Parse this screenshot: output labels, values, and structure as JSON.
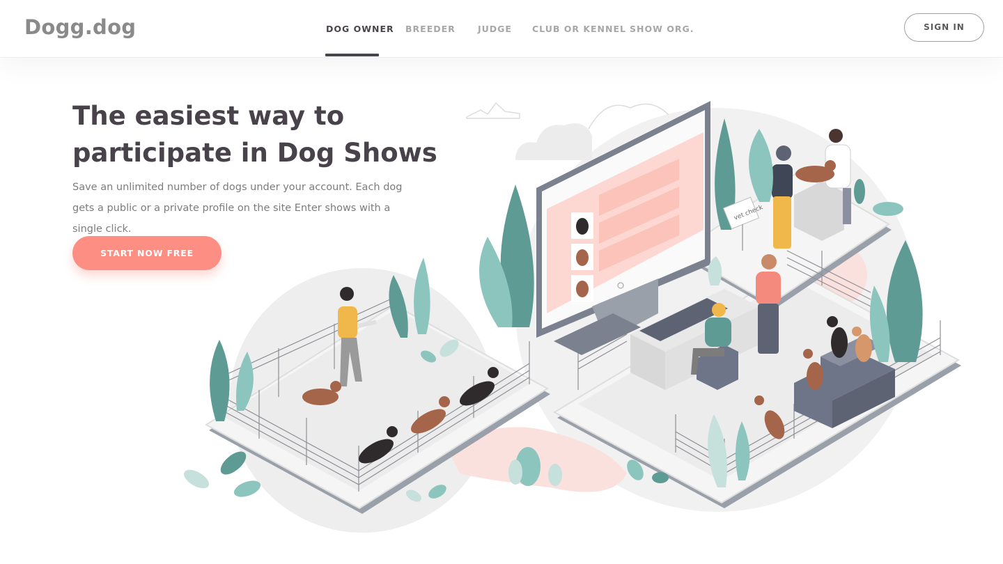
{
  "header": {
    "logo": "Dogg.dog",
    "nav": [
      {
        "label": "DOG OWNER",
        "active": true
      },
      {
        "label": "BREEDER",
        "active": false
      },
      {
        "label": "JUDGE",
        "active": false
      },
      {
        "label": "CLUB OR KENNEL",
        "active": false
      },
      {
        "label": "SHOW ORG.",
        "active": false
      }
    ],
    "signin_label": "SIGN IN"
  },
  "hero": {
    "title": "The easiest way to participate in Dog Shows",
    "subtitle": "Save an unlimited number of dogs under your account. Each dog gets a public or a private profile on the site Enter shows with a single click.",
    "cta_label": "START NOW FREE"
  },
  "illustration": {
    "sign_label": "vet check",
    "icons": [
      "dog-show-illustration",
      "computer-monitor-icon",
      "keyboard-icon",
      "plant-icon",
      "dog-icon",
      "person-icon"
    ]
  },
  "colors": {
    "accent": "#fd8e83",
    "nav_active": "#4a444c",
    "nav_inactive": "#a7a7a7",
    "teal": "#5e9b95",
    "teal_light": "#8cc5bd",
    "dog_brown": "#a5654a",
    "dog_black": "#2f2b2c"
  }
}
